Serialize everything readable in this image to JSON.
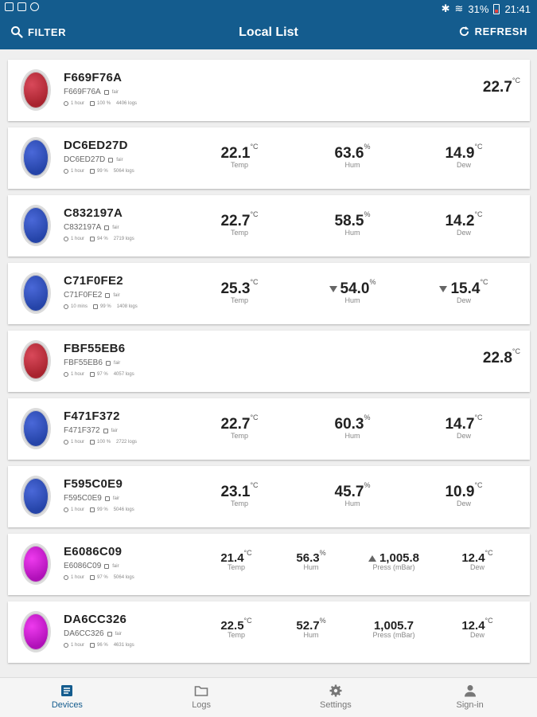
{
  "status_bar": {
    "battery": "31%",
    "time": "21:41"
  },
  "app_bar": {
    "filter_label": "FILTER",
    "title": "Local List",
    "refresh_label": "REFRESH"
  },
  "devices": [
    {
      "name": "F669F76A",
      "sub": "F669F76A",
      "tag": "fair",
      "interval": "1 hour",
      "battery": "100 %",
      "logs": "4406 logs",
      "color": "red",
      "temp_only": "22.7"
    },
    {
      "name": "DC6ED27D",
      "sub": "DC6ED27D",
      "tag": "fair",
      "interval": "1 hour",
      "battery": "99 %",
      "logs": "5064 logs",
      "color": "blue",
      "temp": "22.1",
      "hum": "63.6",
      "dew": "14.9"
    },
    {
      "name": "C832197A",
      "sub": "C832197A",
      "tag": "fair",
      "interval": "1 hour",
      "battery": "94 %",
      "logs": "2719 logs",
      "color": "blue",
      "temp": "22.7",
      "hum": "58.5",
      "dew": "14.2"
    },
    {
      "name": "C71F0FE2",
      "sub": "C71F0FE2",
      "tag": "fair",
      "interval": "10 mins",
      "battery": "99 %",
      "logs": "1408 logs",
      "color": "blue",
      "temp": "25.3",
      "hum": "54.0",
      "dew": "15.4",
      "hum_trend": "down",
      "dew_trend": "down"
    },
    {
      "name": "FBF55EB6",
      "sub": "FBF55EB6",
      "tag": "fair",
      "interval": "1 hour",
      "battery": "97 %",
      "logs": "4057 logs",
      "color": "red",
      "temp_only": "22.8"
    },
    {
      "name": "F471F372",
      "sub": "F471F372",
      "tag": "fair",
      "interval": "1 hour",
      "battery": "100 %",
      "logs": "2722 logs",
      "color": "blue",
      "temp": "22.7",
      "hum": "60.3",
      "dew": "14.7"
    },
    {
      "name": "F595C0E9",
      "sub": "F595C0E9",
      "tag": "fair",
      "interval": "1 hour",
      "battery": "99 %",
      "logs": "5046 logs",
      "color": "blue",
      "temp": "23.1",
      "hum": "45.7",
      "dew": "10.9"
    },
    {
      "name": "E6086C09",
      "sub": "E6086C09",
      "tag": "fair",
      "interval": "1 hour",
      "battery": "97 %",
      "logs": "5064 logs",
      "color": "magenta",
      "temp": "21.4",
      "hum": "56.3",
      "press": "1,005.8",
      "dew": "12.4",
      "press_trend": "up"
    },
    {
      "name": "DA6CC326",
      "sub": "DA6CC326",
      "tag": "fair",
      "interval": "1 hour",
      "battery": "96 %",
      "logs": "4631 logs",
      "color": "magenta",
      "temp": "22.5",
      "hum": "52.7",
      "press": "1,005.7",
      "dew": "12.4"
    }
  ],
  "labels": {
    "temp": "Temp",
    "hum": "Hum",
    "dew": "Dew",
    "press": "Press (mBar)",
    "deg": "°C",
    "pct": "%"
  },
  "nav": [
    {
      "label": "Devices",
      "icon": "list-icon"
    },
    {
      "label": "Logs",
      "icon": "folder-icon"
    },
    {
      "label": "Settings",
      "icon": "gear-icon"
    },
    {
      "label": "Sign-in",
      "icon": "person-icon"
    }
  ],
  "colors": {
    "primary": "#145c8e",
    "red_dot": "#c0303c",
    "blue_dot": "#3050c0",
    "magenta_dot": "#d020d8"
  }
}
